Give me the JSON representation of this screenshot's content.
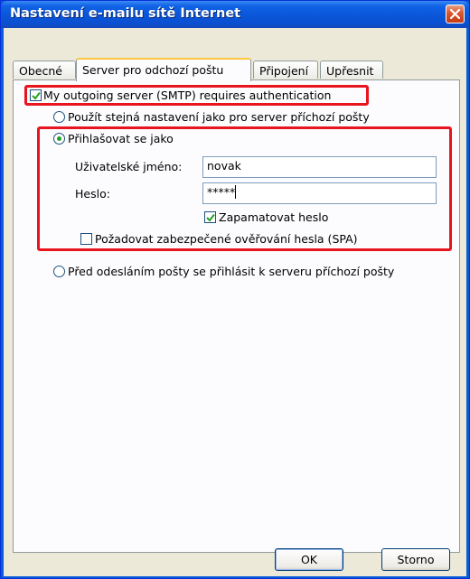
{
  "window": {
    "title": "Nastavení e-mailu sítě Internet"
  },
  "tabs": [
    {
      "label": "Obecné"
    },
    {
      "label": "Server pro odchozí poštu"
    },
    {
      "label": "Připojení"
    },
    {
      "label": "Upřesnit"
    }
  ],
  "active_tab": "Server pro odchozí poštu",
  "panel": {
    "requires_auth": {
      "label": "My outgoing server (SMTP) requires authentication",
      "checked": true
    },
    "option_same": {
      "label": "Použít stejná nastavení jako pro server příchozí pošty",
      "selected": false
    },
    "option_login": {
      "label": "Přihlašovat se jako",
      "selected": true
    },
    "username": {
      "label": "Uživatelské jméno:",
      "value": "novak"
    },
    "password": {
      "label": "Heslo:",
      "value": "*****"
    },
    "remember": {
      "label": "Zapamatovat heslo",
      "checked": true
    },
    "spa": {
      "label": "Požadovat zabezpečené ověřování hesla (SPA)",
      "checked": false
    },
    "option_pop": {
      "label": "Před odesláním pošty se přihlásit k serveru příchozí pošty",
      "selected": false
    }
  },
  "buttons": {
    "ok": "OK",
    "cancel": "Storno"
  },
  "colors": {
    "highlight": "#e8141e",
    "titlebar": "#0a55d8",
    "check": "#21a121"
  }
}
